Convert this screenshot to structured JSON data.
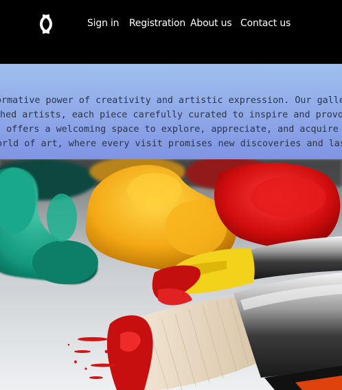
{
  "header": {
    "logo_icon": "double-c-logo-icon",
    "nav": [
      {
        "label": "Sign in"
      },
      {
        "label": "Registration"
      },
      {
        "label": "About us"
      },
      {
        "label": "Contact us"
      }
    ]
  },
  "intro": {
    "lines": [
      "ormative power of creativity and artistic expression. Our gallery",
      "shed artists, each piece carefully curated to inspire and provoke",
      "s offers a welcoming space to explore, appreciate, and acquire",
      "orld of art, where every visit promises new discoveries and last"
    ]
  },
  "hero": {
    "image": "paint-tubes-and-brushes-photo"
  },
  "colors": {
    "header_bg": "#000000",
    "nav_text": "#ffffff",
    "intro_bg_top": "#9ec0ee",
    "intro_bg_bottom": "#7f93e3",
    "intro_text": "#2b3348"
  }
}
